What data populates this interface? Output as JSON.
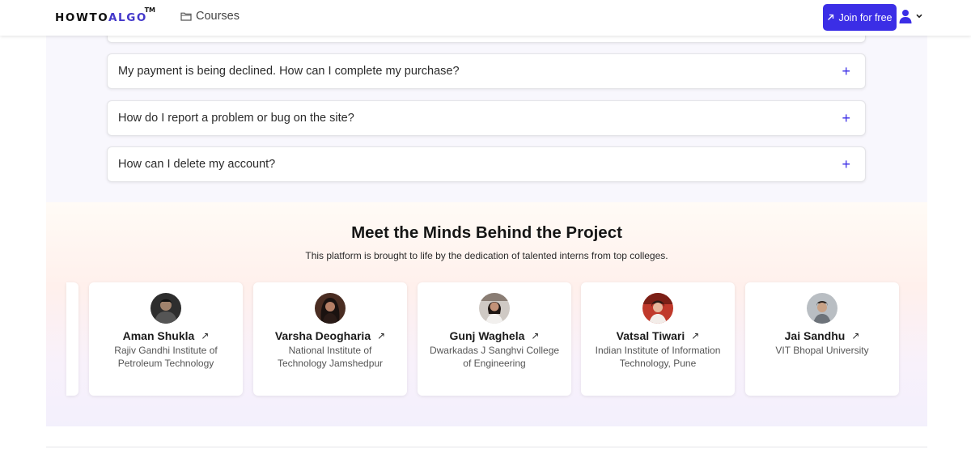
{
  "header": {
    "logo": {
      "part1": "HOWTO",
      "part2": "ALGO",
      "tm": "TM"
    },
    "nav_courses": "Courses",
    "join_button": "Join for free"
  },
  "faq": [
    {
      "question": "My payment is being declined. How can I complete my purchase?"
    },
    {
      "question": "How do I report a problem or bug on the site?"
    },
    {
      "question": "How can I delete my account?"
    }
  ],
  "team": {
    "title": "Meet the Minds Behind the Project",
    "subtitle": "This platform is brought to life by the dedication of talented interns from top colleges.",
    "members": [
      {
        "name": "Aman Shukla",
        "college": "Rajiv Gandhi Institute of Petroleum Technology"
      },
      {
        "name": "Varsha Deogharia",
        "college": "National Institute of Technology Jamshedpur"
      },
      {
        "name": "Gunj Waghela",
        "college": "Dwarkadas J Sanghvi College of Engineering"
      },
      {
        "name": "Vatsal Tiwari",
        "college": "Indian Institute of Information Technology, Pune"
      },
      {
        "name": "Jai Sandhu",
        "college": "VIT Bhopal University"
      }
    ]
  },
  "colors": {
    "accent": "#3b2ee6",
    "faq_bg": "#f8f7fd"
  },
  "icons": {
    "courses": "folder-icon",
    "join": "arrow-up-right-icon",
    "user": "user-icon",
    "caret": "chevron-down-icon",
    "faq_toggle": "plus-icon",
    "profile_link": "arrow-up-right-icon"
  }
}
